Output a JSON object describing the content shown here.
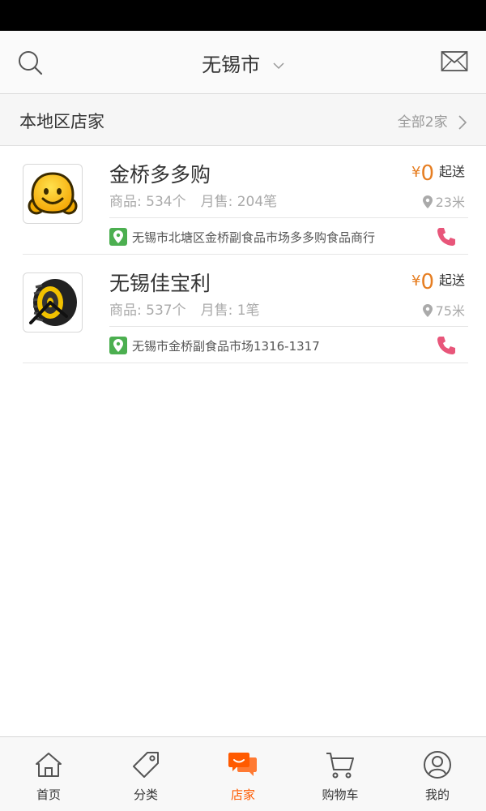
{
  "header": {
    "city": "无锡市",
    "icons": {
      "search": "search-icon",
      "mail": "mail-icon",
      "chevron": "chevron-down-icon"
    }
  },
  "section": {
    "title": "本地区店家",
    "all_label": "全部2家"
  },
  "stores": [
    {
      "name": "金桥多多购",
      "stats_goods": "商品: 534个",
      "stats_sales": "月售: 204笔",
      "price_currency": "¥",
      "price_value": "0",
      "min_label": "起送",
      "distance": "23米",
      "address": "无锡市北塘区金桥副食品市场多多购食品商行",
      "logo": "smiley-logo"
    },
    {
      "name": "无锡佳宝利",
      "stats_goods": "商品: 537个",
      "stats_sales": "月售: 1笔",
      "price_currency": "¥",
      "price_value": "0",
      "min_label": "起送",
      "distance": "75米",
      "address": "无锡市金桥副食品市场1316-1317",
      "logo": "wheel-logo"
    }
  ],
  "tabs": [
    {
      "label": "首页",
      "icon": "home-icon"
    },
    {
      "label": "分类",
      "icon": "tag-icon"
    },
    {
      "label": "店家",
      "icon": "chat-icon",
      "active": true
    },
    {
      "label": "购物车",
      "icon": "cart-icon"
    },
    {
      "label": "我的",
      "icon": "user-icon"
    }
  ],
  "colors": {
    "accent": "#ff5a00",
    "price": "#e67e22",
    "pin": "#4caf50",
    "phone": "#e8567a"
  }
}
